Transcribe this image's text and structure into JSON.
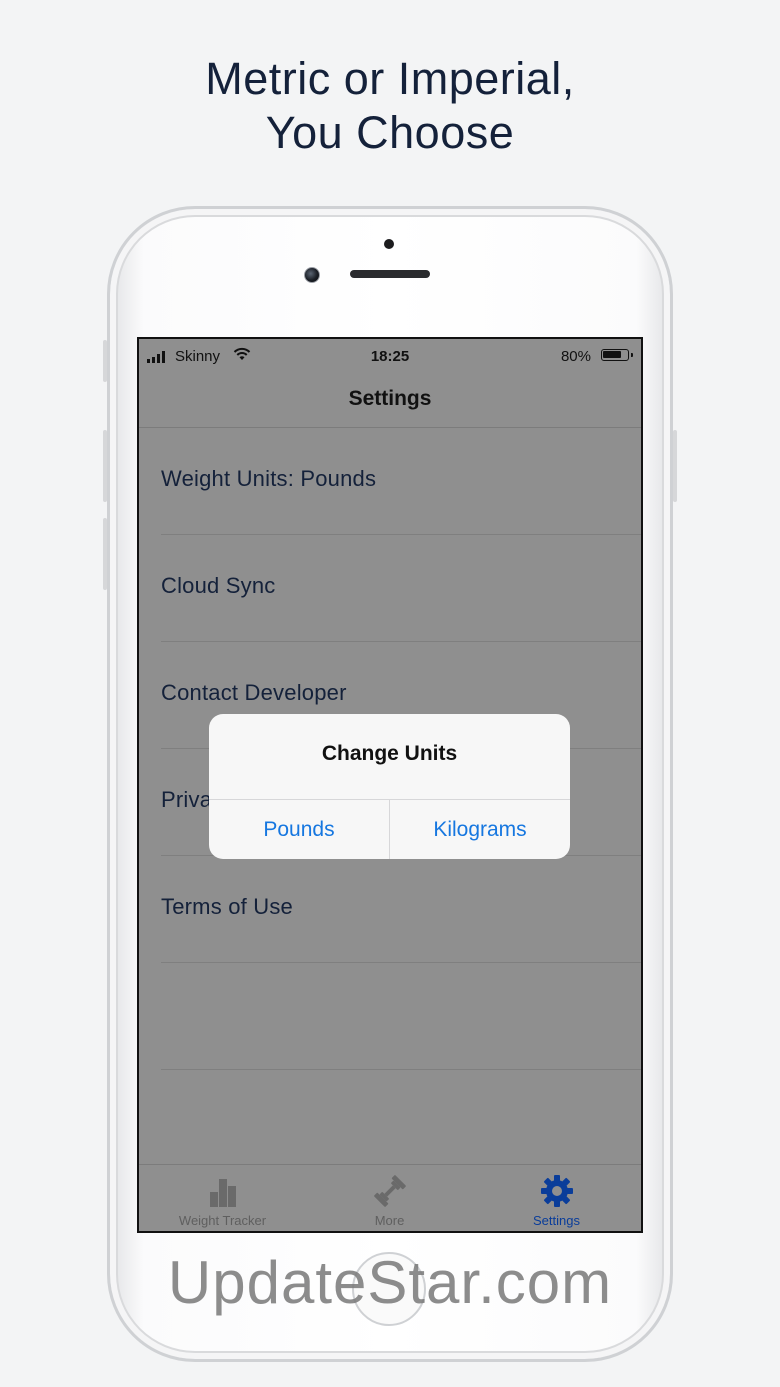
{
  "headline": {
    "line1": "Metric or Imperial,",
    "line2": "You Choose"
  },
  "status_bar": {
    "carrier": "Skinny",
    "time": "18:25",
    "battery": "80%",
    "battery_level": 0.8
  },
  "nav": {
    "title": "Settings"
  },
  "settings_rows": [
    {
      "label": "Weight Units: Pounds"
    },
    {
      "label": "Cloud Sync"
    },
    {
      "label": "Contact Developer"
    },
    {
      "label": "Priva"
    },
    {
      "label": "Terms of Use"
    },
    {
      "label": ""
    },
    {
      "label": ""
    }
  ],
  "alert": {
    "title": "Change Units",
    "option_left": "Pounds",
    "option_right": "Kilograms"
  },
  "tabs": [
    {
      "label": "Weight Tracker",
      "icon": "bar-chart-icon"
    },
    {
      "label": "More",
      "icon": "dumbbell-icon"
    },
    {
      "label": "Settings",
      "icon": "gear-icon",
      "active": true
    }
  ],
  "colors": {
    "accent": "#1677e0",
    "tab_active": "#0a3d9a",
    "dim_overlay": "#8f8f8f",
    "text_dark": "#14213a"
  },
  "watermark": "UpdateStar.com"
}
